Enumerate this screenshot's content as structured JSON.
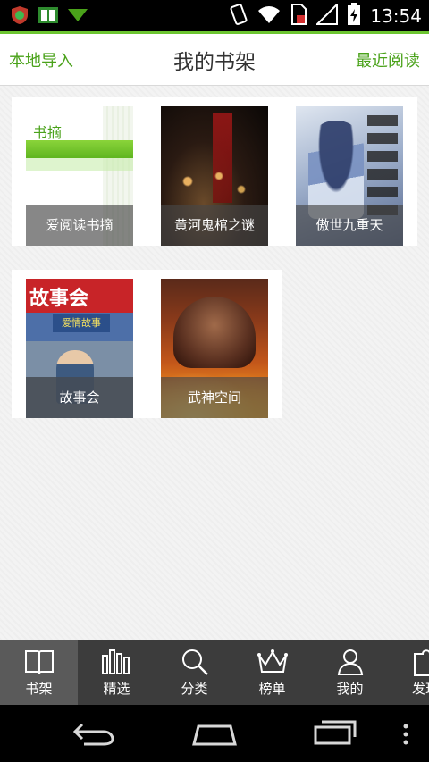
{
  "status_bar": {
    "time": "13:54",
    "icons": [
      "app-shield-icon",
      "book-icon",
      "download-icon",
      "vibrate-icon",
      "wifi-icon",
      "sim-error-icon",
      "signal-icon",
      "battery-charging-icon"
    ]
  },
  "header": {
    "left_action": "本地导入",
    "title": "我的书架",
    "right_action": "最近阅读"
  },
  "shelf": {
    "books": [
      {
        "title": "爱阅读书摘",
        "cover_label": "书摘"
      },
      {
        "title": "黄河鬼棺之谜"
      },
      {
        "title": "傲世九重天"
      },
      {
        "title": "故事会",
        "cover_mast": "故事会",
        "cover_sub": "爱情故事"
      },
      {
        "title": "武神空间"
      }
    ]
  },
  "tabs": [
    {
      "label": "书架",
      "icon": "book-open-icon",
      "active": true
    },
    {
      "label": "精选",
      "icon": "bars-icon",
      "active": false
    },
    {
      "label": "分类",
      "icon": "search-icon",
      "active": false
    },
    {
      "label": "榜单",
      "icon": "crown-icon",
      "active": false
    },
    {
      "label": "我的",
      "icon": "person-icon",
      "active": false
    },
    {
      "label": "发现",
      "icon": "puzzle-icon",
      "active": false
    }
  ],
  "colors": {
    "accent": "#4aa21a",
    "header_rule": "#6cc531",
    "tabbar": "#3c3c3c",
    "tab_active": "#5a5a5a"
  }
}
